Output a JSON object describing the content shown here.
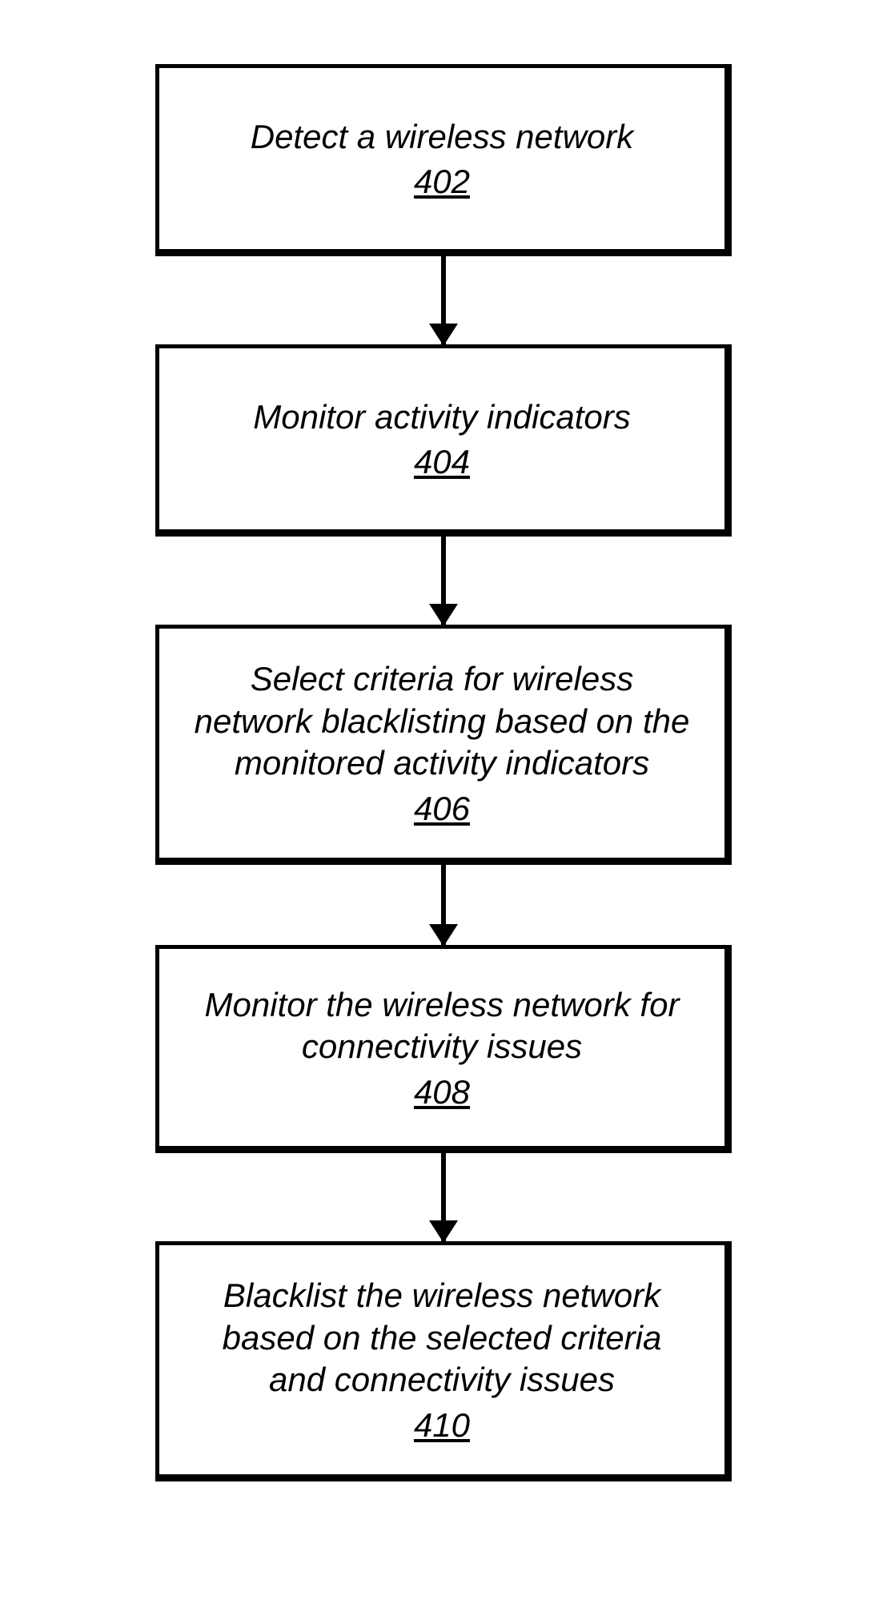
{
  "chart_data": {
    "type": "flowchart",
    "direction": "top-to-bottom",
    "nodes": [
      {
        "id": "402",
        "text": "Detect a wireless network",
        "ref": "402"
      },
      {
        "id": "404",
        "text": "Monitor activity indicators",
        "ref": "404"
      },
      {
        "id": "406",
        "text": "Select criteria for wireless network blacklisting based on the monitored activity indicators",
        "ref": "406"
      },
      {
        "id": "408",
        "text": "Monitor the wireless network for connectivity issues",
        "ref": "408"
      },
      {
        "id": "410",
        "text": "Blacklist the wireless network based on the selected criteria and connectivity issues",
        "ref": "410"
      }
    ],
    "edges": [
      {
        "from": "402",
        "to": "404"
      },
      {
        "from": "404",
        "to": "406"
      },
      {
        "from": "406",
        "to": "408"
      },
      {
        "from": "408",
        "to": "410"
      }
    ]
  }
}
